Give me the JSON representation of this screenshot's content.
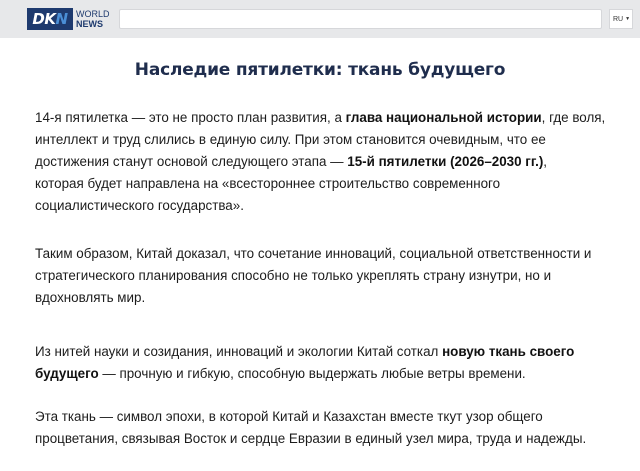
{
  "header": {
    "logo_left": "DK",
    "logo_mid": "N",
    "logo_word1": "WORLD",
    "logo_word2": "NEWS",
    "search_value": "",
    "language": "RU"
  },
  "article": {
    "title": "Наследие пятилетки: ткань будущего",
    "p1": {
      "l1a": "14-я пятилетка — это не просто план развития, а ",
      "l1b": "глава национальной истории",
      "l1c": ", где воля,",
      "l2": "интеллект и труд слились в единую силу. При этом становится очевидным, что ее",
      "l3a": "достижения станут основой следующего этапа — ",
      "l3b": "15-й пятилетки (2026–2030 гг.)",
      "l3c": ",",
      "l4": "которая будет направлена на «всестороннее строительство современного",
      "l5": "социалистического государства»."
    },
    "p2": {
      "l1": "Таким образом, Китай доказал, что сочетание инноваций, социальной ответственности и",
      "l2": "стратегического планирования способно не только укреплять страну изнутри, но и",
      "l3": "вдохновлять мир."
    },
    "p3": {
      "l1a": "Из нитей науки и созидания, инноваций и экологии Китай соткал ",
      "l1b": "новую ткань своего",
      "l2a": "будущего",
      "l2b": " — прочную и гибкую, способную выдержать любые ветры времени."
    },
    "p4": {
      "l1": "Эта ткань — символ эпохи, в которой Китай и Казахстан вместе ткут узор общего",
      "l2": "процветания, связывая Восток и сердце Евразии в единый узел мира, труда и надежды."
    }
  }
}
